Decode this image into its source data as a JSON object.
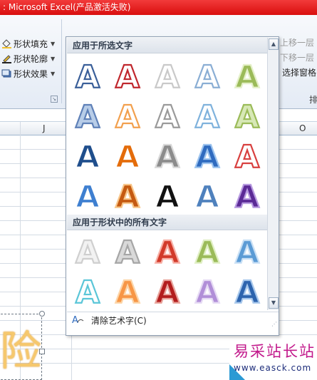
{
  "title_bar": {
    "text": ": Microsoft Excel(产品激活失败)"
  },
  "ribbon": {
    "shape_fill": "形状填充",
    "shape_outline": "形状轮廓",
    "shape_effects": "形状效果",
    "bring_forward": "上移一层",
    "send_backward": "下移一层",
    "selection_pane": "选择窗格",
    "arrange_group": "排"
  },
  "sheet": {
    "columns": [
      "J",
      "O"
    ],
    "glyph": "险"
  },
  "gallery": {
    "section1_title": "应用于所选文字",
    "section2_title": "应用于形状中的所有文字",
    "clear_label": "清除艺术字(C)",
    "letter": "A",
    "section1_styles": [
      {
        "fill": "#ffffff",
        "stroke": "#3a5f99"
      },
      {
        "fill": "#ffffff",
        "stroke": "#c0272d"
      },
      {
        "fill": "#ffffff",
        "stroke": "#c9c9c9"
      },
      {
        "fill": "#ffffff",
        "stroke": "#8aaed4"
      },
      {
        "fill": "#9bbb59",
        "stroke": "#e4f0c8"
      },
      {
        "fill": "#b8cde8",
        "stroke": "#5f81b8"
      },
      {
        "fill": "#ffffff",
        "stroke": "#f2a04e"
      },
      {
        "fill": "#ffffff",
        "stroke": "#9a9a9a"
      },
      {
        "fill": "#ffffff",
        "stroke": "#7fb2dc"
      },
      {
        "fill": "#d7e8b6",
        "stroke": "#9bbb59"
      },
      {
        "fill": "#1f4e8c",
        "stroke": "#ffffff"
      },
      {
        "fill": "#e46c0a",
        "stroke": "#ffffff"
      },
      {
        "fill": "#8c8c8c",
        "stroke": "#d9d9d9"
      },
      {
        "fill": "#2f6bbf",
        "stroke": "#9cc3ee"
      },
      {
        "fill": "#ffffff",
        "stroke": "#d8403f"
      },
      {
        "fill": "#3e7fd0",
        "stroke": "#ffffff"
      },
      {
        "fill": "#c55a11",
        "stroke": "#f8c68a"
      },
      {
        "fill": "#111111",
        "stroke": "#ffffff"
      },
      {
        "fill": "#4f81bd",
        "stroke": "#ffffff"
      },
      {
        "fill": "#5b2a96",
        "stroke": "#b79ae0"
      }
    ],
    "section2_styles": [
      {
        "fill": "#f2f2f2",
        "stroke": "#cfcfcf"
      },
      {
        "fill": "#d9d9d9",
        "stroke": "#a6a6a6"
      },
      {
        "fill": "#d23a2a",
        "stroke": "#f7b0a6"
      },
      {
        "fill": "#9bbb59",
        "stroke": "#e0efc4"
      },
      {
        "fill": "#5b9bd5",
        "stroke": "#c9e0f5"
      },
      {
        "fill": "#ffffff",
        "stroke": "#5bc6d8"
      },
      {
        "fill": "#f79646",
        "stroke": "#fcd5a8"
      },
      {
        "fill": "#b31d1d",
        "stroke": "#e8a39b"
      },
      {
        "fill": "#b18fd8",
        "stroke": "#e6dbf4"
      },
      {
        "fill": "#2d64ae",
        "stroke": "#a8c8ec"
      }
    ]
  }
}
